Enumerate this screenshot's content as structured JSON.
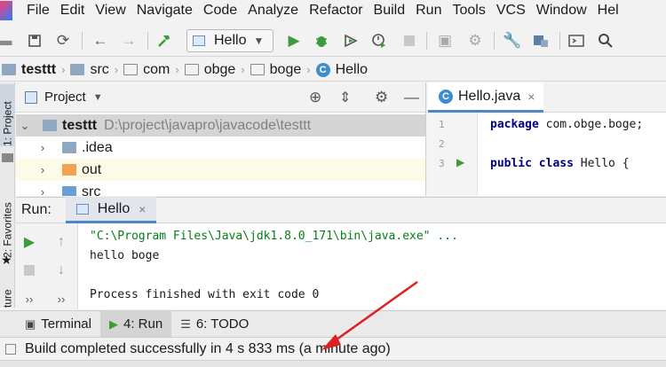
{
  "menu": [
    "File",
    "Edit",
    "View",
    "Navigate",
    "Code",
    "Analyze",
    "Refactor",
    "Build",
    "Run",
    "Tools",
    "VCS",
    "Window",
    "Hel"
  ],
  "toolbar": {
    "run_config": "Hello",
    "icons": [
      "open-folder-icon",
      "save-icon",
      "sync-icon",
      "back-icon",
      "forward-icon",
      "build-hammer-icon",
      "run-icon",
      "debug-icon",
      "run-coverage-icon",
      "profile-icon",
      "stop-icon",
      "vcs-icon",
      "vcs-update-icon",
      "wrench-settings-icon",
      "project-structure-icon",
      "terminal-window-icon",
      "search-icon"
    ]
  },
  "breadcrumb": [
    "testtt",
    "src",
    "com",
    "obge",
    "boge",
    "Hello"
  ],
  "left_stripe": {
    "project": "1: Project",
    "favorites": "2: Favorites",
    "structure": "ture"
  },
  "project_panel": {
    "title": "Project",
    "tree": [
      {
        "name": "testtt",
        "path": "D:\\project\\javapro\\javacode\\testtt",
        "expanded": true
      },
      {
        "name": ".idea",
        "expanded": false
      },
      {
        "name": "out",
        "expanded": false
      },
      {
        "name": "src",
        "expanded": false
      }
    ]
  },
  "editor": {
    "tab": "Hello.java",
    "lines": [
      {
        "num": "1",
        "kw": "package",
        "rest": " com.obge.boge;"
      },
      {
        "num": "2",
        "kw": "",
        "rest": ""
      },
      {
        "num": "3",
        "kw": "public class",
        "rest": " Hello {"
      }
    ]
  },
  "run_panel": {
    "label": "Run:",
    "tab": "Hello",
    "console": [
      "\"C:\\Program Files\\Java\\jdk1.8.0_171\\bin\\java.exe\" ...",
      "hello boge",
      "",
      "Process finished with exit code 0"
    ],
    "more": "››"
  },
  "bottom_tabs": [
    {
      "label": "Terminal",
      "icon": "terminal-icon"
    },
    {
      "label": "4: Run",
      "icon": "run-icon"
    },
    {
      "label": "6: TODO",
      "icon": "todo-icon"
    }
  ],
  "status": "Build completed successfully in 4 s 833 ms (a minute ago)",
  "colors": {
    "accent": "#4a88c7",
    "run_green": "#3c9b3c",
    "arrow_red": "#e02020",
    "keyword": "#000080",
    "console_green": "#067d17"
  }
}
